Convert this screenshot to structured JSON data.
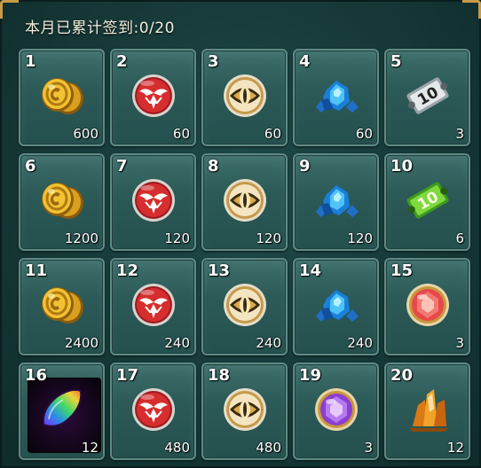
{
  "title": "本月已累计签到:0/20",
  "rewards": [
    {
      "num": "1",
      "qty": "600",
      "icon": "gold-coins-icon"
    },
    {
      "num": "2",
      "qty": "60",
      "icon": "red-emblem-icon"
    },
    {
      "num": "3",
      "qty": "60",
      "icon": "gold-eye-token-icon"
    },
    {
      "num": "4",
      "qty": "60",
      "icon": "blue-gems-icon"
    },
    {
      "num": "5",
      "qty": "3",
      "icon": "silver-10-ticket-icon"
    },
    {
      "num": "6",
      "qty": "1200",
      "icon": "gold-coins-icon"
    },
    {
      "num": "7",
      "qty": "120",
      "icon": "red-emblem-icon"
    },
    {
      "num": "8",
      "qty": "120",
      "icon": "gold-eye-token-icon"
    },
    {
      "num": "9",
      "qty": "120",
      "icon": "blue-gems-icon"
    },
    {
      "num": "10",
      "qty": "6",
      "icon": "green-10-ticket-icon"
    },
    {
      "num": "11",
      "qty": "2400",
      "icon": "gold-coins-icon"
    },
    {
      "num": "12",
      "qty": "240",
      "icon": "red-emblem-icon"
    },
    {
      "num": "13",
      "qty": "240",
      "icon": "gold-eye-token-icon"
    },
    {
      "num": "14",
      "qty": "240",
      "icon": "blue-gems-icon"
    },
    {
      "num": "15",
      "qty": "3",
      "icon": "red-gem-orb-icon"
    },
    {
      "num": "16",
      "qty": "12",
      "icon": "rainbow-crystal-icon"
    },
    {
      "num": "17",
      "qty": "480",
      "icon": "red-emblem-icon"
    },
    {
      "num": "18",
      "qty": "480",
      "icon": "gold-eye-token-icon"
    },
    {
      "num": "19",
      "qty": "3",
      "icon": "purple-gem-orb-icon"
    },
    {
      "num": "20",
      "qty": "12",
      "icon": "orange-crystal-icon"
    }
  ]
}
